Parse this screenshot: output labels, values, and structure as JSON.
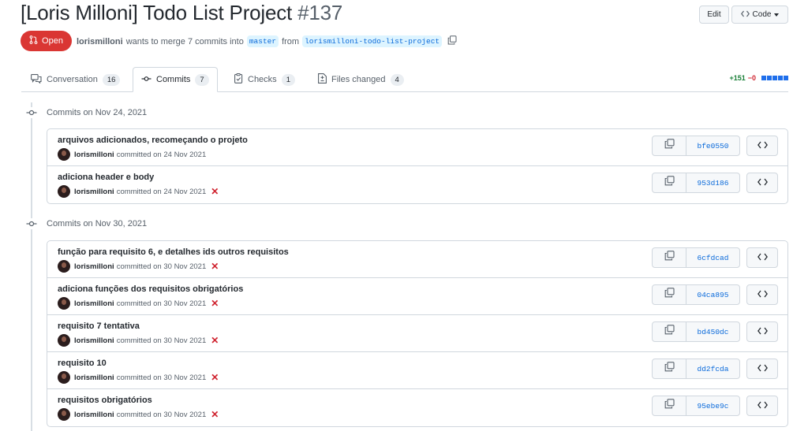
{
  "pr": {
    "title": "[Loris Milloni] Todo List Project",
    "number": "#137",
    "edit_label": "Edit",
    "code_label": "Code",
    "state": "Open",
    "author": "lorismilloni",
    "merge_text": "wants to merge 7 commits into",
    "base_branch": "master",
    "from_text": "from",
    "head_branch": "lorismilloni-todo-list-project"
  },
  "tabs": [
    {
      "label": "Conversation",
      "count": "16",
      "icon": "conversation-icon"
    },
    {
      "label": "Commits",
      "count": "7",
      "icon": "commit-icon"
    },
    {
      "label": "Checks",
      "count": "1",
      "icon": "checks-icon"
    },
    {
      "label": "Files changed",
      "count": "4",
      "icon": "file-diff-icon"
    }
  ],
  "diffstat": {
    "additions": "+151",
    "deletions": "−0"
  },
  "groups": [
    {
      "label": "Commits on Nov 24, 2021",
      "commits": [
        {
          "message": "arquivos adicionados, recomeçando o projeto",
          "author": "lorismilloni",
          "verb": "committed on",
          "date": "24 Nov 2021",
          "sha": "bfe0550",
          "status": "none"
        },
        {
          "message": "adiciona header e body",
          "author": "lorismilloni",
          "verb": "committed on",
          "date": "24 Nov 2021",
          "sha": "953d186",
          "status": "failure"
        }
      ]
    },
    {
      "label": "Commits on Nov 30, 2021",
      "commits": [
        {
          "message": "função para requisito 6, e detalhes ids outros requisitos",
          "author": "lorismilloni",
          "verb": "committed on",
          "date": "30 Nov 2021",
          "sha": "6cfdcad",
          "status": "failure"
        },
        {
          "message": "adiciona funções dos requisitos obrigatórios",
          "author": "lorismilloni",
          "verb": "committed on",
          "date": "30 Nov 2021",
          "sha": "04ca895",
          "status": "failure"
        },
        {
          "message": "requisito 7 tentativa",
          "author": "lorismilloni",
          "verb": "committed on",
          "date": "30 Nov 2021",
          "sha": "bd450dc",
          "status": "failure"
        },
        {
          "message": "requisito 10",
          "author": "lorismilloni",
          "verb": "committed on",
          "date": "30 Nov 2021",
          "sha": "dd2fcda",
          "status": "failure"
        },
        {
          "message": "requisitos obrigatórios",
          "author": "lorismilloni",
          "verb": "committed on",
          "date": "30 Nov 2021",
          "sha": "95ebe9c",
          "status": "failure"
        }
      ]
    }
  ],
  "colors": {
    "open_state": "#da3633",
    "link": "#0969da",
    "failure": "#cf222e",
    "additions": "#1a7f37"
  }
}
